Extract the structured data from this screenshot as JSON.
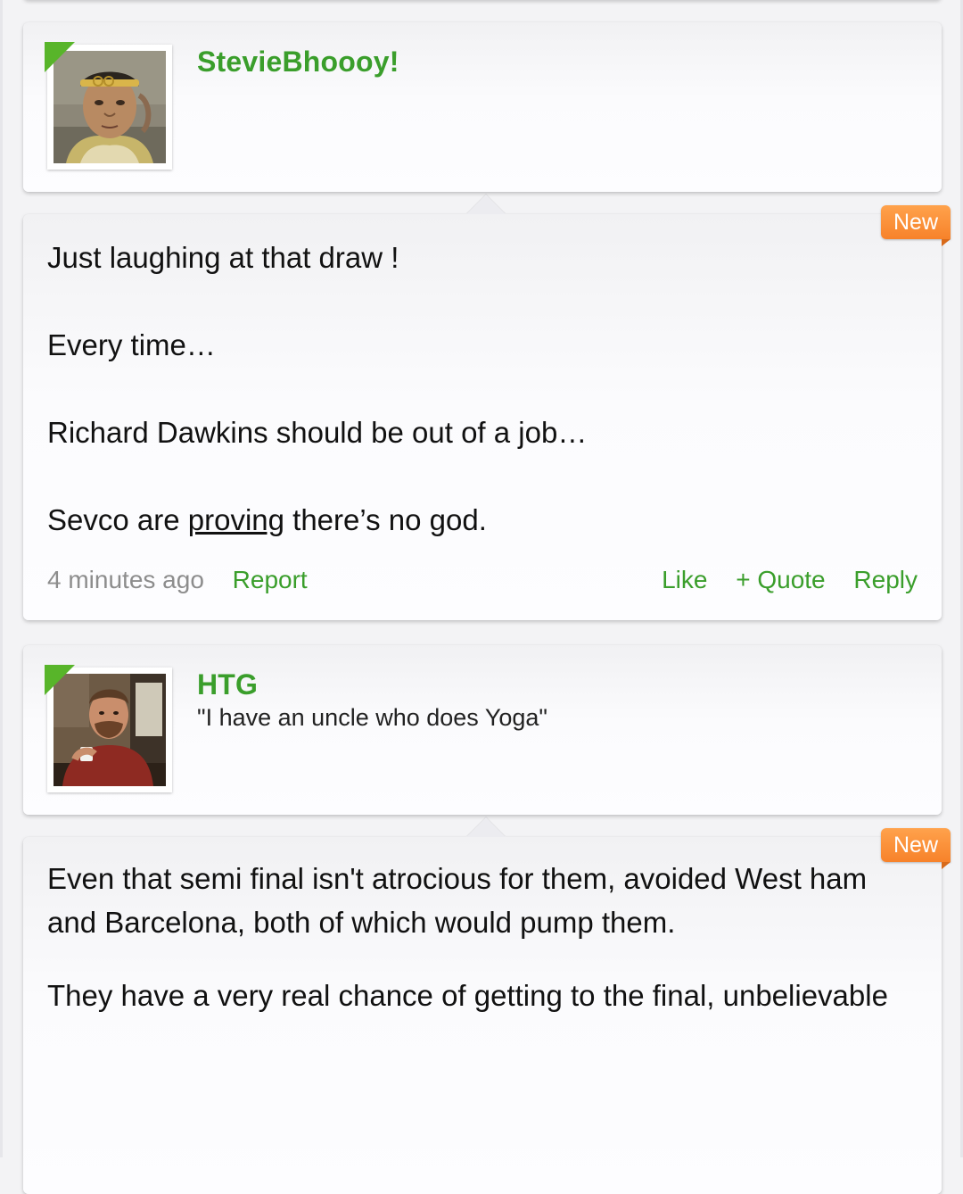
{
  "posts": [
    {
      "author": {
        "username": "StevieBhoooy!",
        "title": "",
        "avatar_icon": "avatar-warrior-headband"
      },
      "badge": "New",
      "body": {
        "line1": "Just laughing at that draw !",
        "line2": "Every time…",
        "line3": "Richard Dawkins should be out of a job…",
        "line4_before": "Sevco are ",
        "line4_underlined": "proving",
        "line4_after": " there’s no god."
      },
      "meta": {
        "time": "4 minutes ago",
        "report": "Report",
        "like": "Like",
        "quote": "+ Quote",
        "reply": "Reply"
      }
    },
    {
      "author": {
        "username": "HTG",
        "title": "\"I have an uncle who does Yoga\"",
        "avatar_icon": "avatar-mustache-man-mug"
      },
      "badge": "New",
      "body": {
        "line1": "Even that semi final isn't atrocious for them, avoided West ham and Barcelona, both of which would pump them.",
        "line2": "They have a very real chance of getting to the final, unbelievable"
      }
    }
  ],
  "colors": {
    "accent_green": "#3a9e2b",
    "badge_orange": "#f7822a",
    "meta_gray": "#8d8d8d"
  }
}
